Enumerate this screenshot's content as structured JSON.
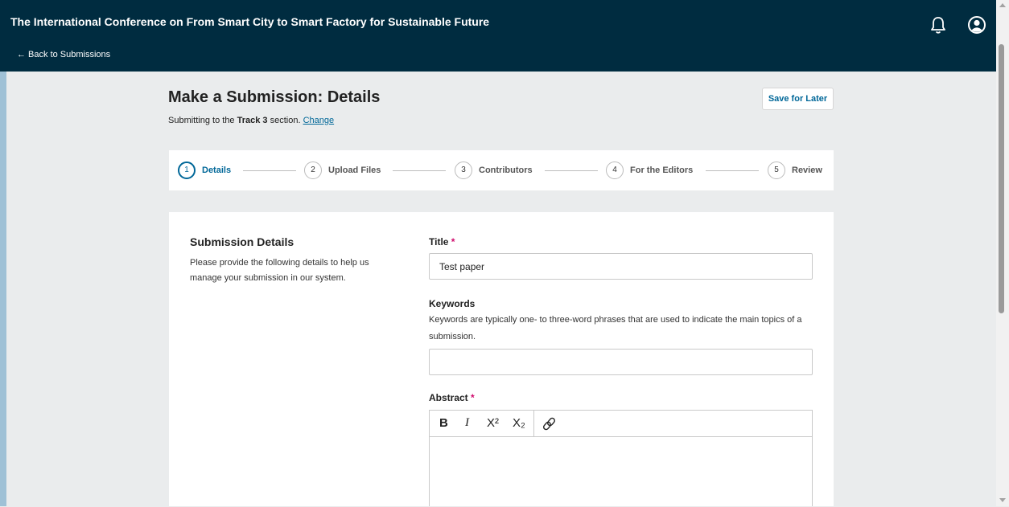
{
  "header": {
    "context_title": "The International Conference on From Smart City to Smart Factory for Sustainable Future",
    "back_link": "← Back to Submissions",
    "icons": [
      "bell-icon",
      "user-account-icon"
    ],
    "background": "#002c40"
  },
  "page": {
    "title": "Make a Submission: Details",
    "subtitle_prefix": "Submitting to the ",
    "section_name": "Track 3",
    "subtitle_suffix": " section. ",
    "change_link": "Change",
    "save_button": "Save for Later"
  },
  "steps": [
    {
      "number": "1",
      "label": "Details",
      "active": true
    },
    {
      "number": "2",
      "label": "Upload Files",
      "active": false
    },
    {
      "number": "3",
      "label": "Contributors",
      "active": false
    },
    {
      "number": "4",
      "label": "For the Editors",
      "active": false
    },
    {
      "number": "5",
      "label": "Review",
      "active": false
    }
  ],
  "form": {
    "section_title": "Submission Details",
    "section_description": "Please provide the following details to help us manage your submission in our system.",
    "title_label": "Title",
    "title_value": "Test paper",
    "keywords_label": "Keywords",
    "keywords_description": "Keywords are typically one- to three-word phrases that are used to indicate the main topics of a submission.",
    "keywords_value": "",
    "abstract_label": "Abstract",
    "required_marker": "*",
    "toolbar": {
      "bold": "B",
      "italic": "I",
      "superscript": "X²",
      "subscript": "X₂",
      "link_icon": "link-icon"
    }
  },
  "colors": {
    "accent": "#006798",
    "required": "#d00a6c",
    "page_background": "#eaeced"
  }
}
